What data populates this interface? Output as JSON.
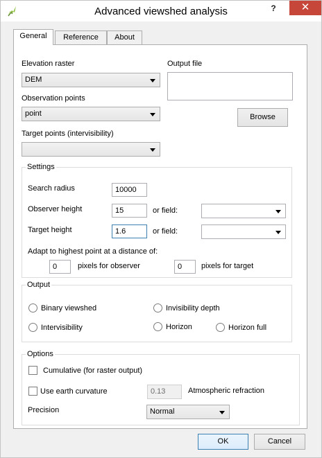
{
  "window": {
    "title": "Advanced viewshed analysis",
    "help": "?",
    "close": "✕"
  },
  "tabs": [
    {
      "label": "General",
      "active": true
    },
    {
      "label": "Reference",
      "active": false
    },
    {
      "label": "About",
      "active": false
    }
  ],
  "general": {
    "elevation_label": "Elevation raster",
    "elevation_value": "DEM",
    "output_label": "Output file",
    "output_value": "",
    "observation_label": "Observation points",
    "observation_value": "point",
    "browse_label": "Browse",
    "target_label": "Target points (intervisibility)",
    "target_value": ""
  },
  "settings": {
    "title": "Settings",
    "search_radius_label": "Search radius",
    "search_radius_value": "10000",
    "observer_height_label": "Observer height",
    "observer_height_value": "15",
    "observer_or_field": "or field:",
    "observer_field_value": "",
    "target_height_label": "Target height",
    "target_height_value": "1.6",
    "target_or_field": "or field:",
    "target_field_value": "",
    "adapt_label": "Adapt to highest point at a distance of:",
    "observer_pixels_value": "0",
    "observer_pixels_label": "pixels for observer",
    "target_pixels_value": "0",
    "target_pixels_label": "pixels for target"
  },
  "output": {
    "title": "Output",
    "binary": "Binary viewshed",
    "invisibility": "Invisibility depth",
    "intervisibility": "Intervisibility",
    "horizon": "Horizon",
    "horizon_full": "Horizon full"
  },
  "options": {
    "title": "Options",
    "cumulative": "Cumulative (for raster output)",
    "earth_curvature": "Use earth curvature",
    "refraction_value": "0.13",
    "refraction_label": "Atmospheric refraction",
    "precision_label": "Precision",
    "precision_value": "Normal"
  },
  "footer": {
    "ok": "OK",
    "cancel": "Cancel"
  },
  "colors": {
    "close_button": "#c7463a",
    "default_button_border": "#3c7fb1"
  }
}
